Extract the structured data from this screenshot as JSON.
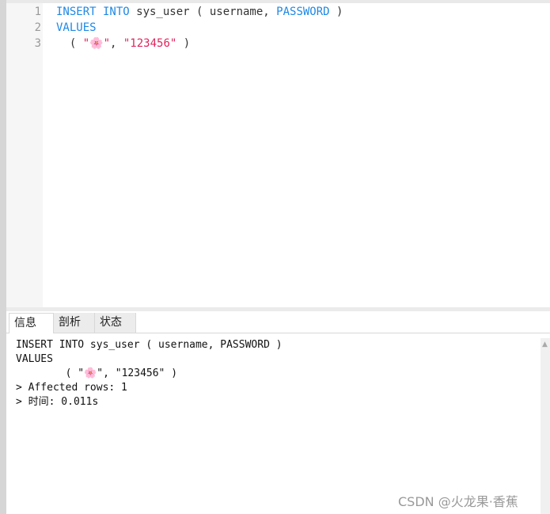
{
  "editor": {
    "line_numbers": [
      "1",
      "2",
      "3"
    ],
    "line1": {
      "kw1": "INSERT INTO",
      "plain1": " sys_user ( username, ",
      "kw2": "PASSWORD",
      "plain2": " )"
    },
    "line2": {
      "kw1": "VALUES"
    },
    "line3": {
      "p1": "  ( ",
      "s1": "\"🌸\"",
      "p2": ", ",
      "s2": "\"123456\"",
      "p3": " )"
    }
  },
  "tabs": [
    {
      "label": "信息",
      "active": true
    },
    {
      "label": "剖析"
    },
    {
      "label": "状态"
    }
  ],
  "output": {
    "lines": [
      "INSERT INTO sys_user ( username, PASSWORD )",
      "VALUES",
      "\t( \"🌸\", \"123456\" )",
      "> Affected rows: 1",
      "> 时间: 0.011s"
    ]
  },
  "watermark": "CSDN @火龙果·香蕉",
  "colors": {
    "keyword": "#1e88e5",
    "string": "#e0245e"
  }
}
